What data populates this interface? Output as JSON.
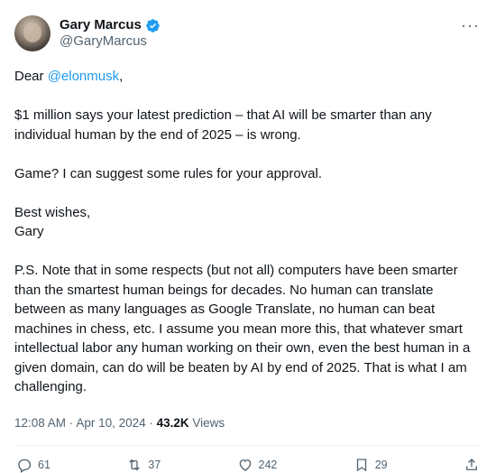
{
  "author": {
    "display_name": "Gary Marcus",
    "handle": "@GaryMarcus"
  },
  "more_label": "···",
  "tweet": {
    "greeting_prefix": "Dear ",
    "mention": "@elonmusk",
    "greeting_suffix": ",",
    "para1": "$1 million says your latest prediction – that AI will be smarter than any individual human by the end of 2025 – is wrong.",
    "para2": "Game? I can suggest some rules for your approval.",
    "signoff_line1": "Best wishes,",
    "signoff_line2": "Gary",
    "ps": "P.S. Note that in some respects (but not all)  computers have been smarter than the smartest human beings for decades. No human can translate between as many languages as Google Translate, no human can beat machines in chess, etc. I assume you mean more this, that whatever smart intellectual labor any human working on their own, even the best human in a given domain, can do will be beaten by AI by end of 2025. That is what I am challenging."
  },
  "meta": {
    "time": "12:08 AM",
    "separator": " · ",
    "date": "Apr 10, 2024",
    "separator2": " · ",
    "views_count": "43.2K",
    "views_label": " Views"
  },
  "actions": {
    "replies": "61",
    "reposts": "37",
    "likes": "242",
    "bookmarks": "29"
  },
  "icons": {
    "verified": "verified-badge-icon",
    "reply": "reply-icon",
    "repost": "repost-icon",
    "like": "heart-icon",
    "bookmark": "bookmark-icon",
    "share": "share-icon"
  },
  "colors": {
    "accent": "#1d9bf0",
    "secondary_text": "#536471"
  }
}
